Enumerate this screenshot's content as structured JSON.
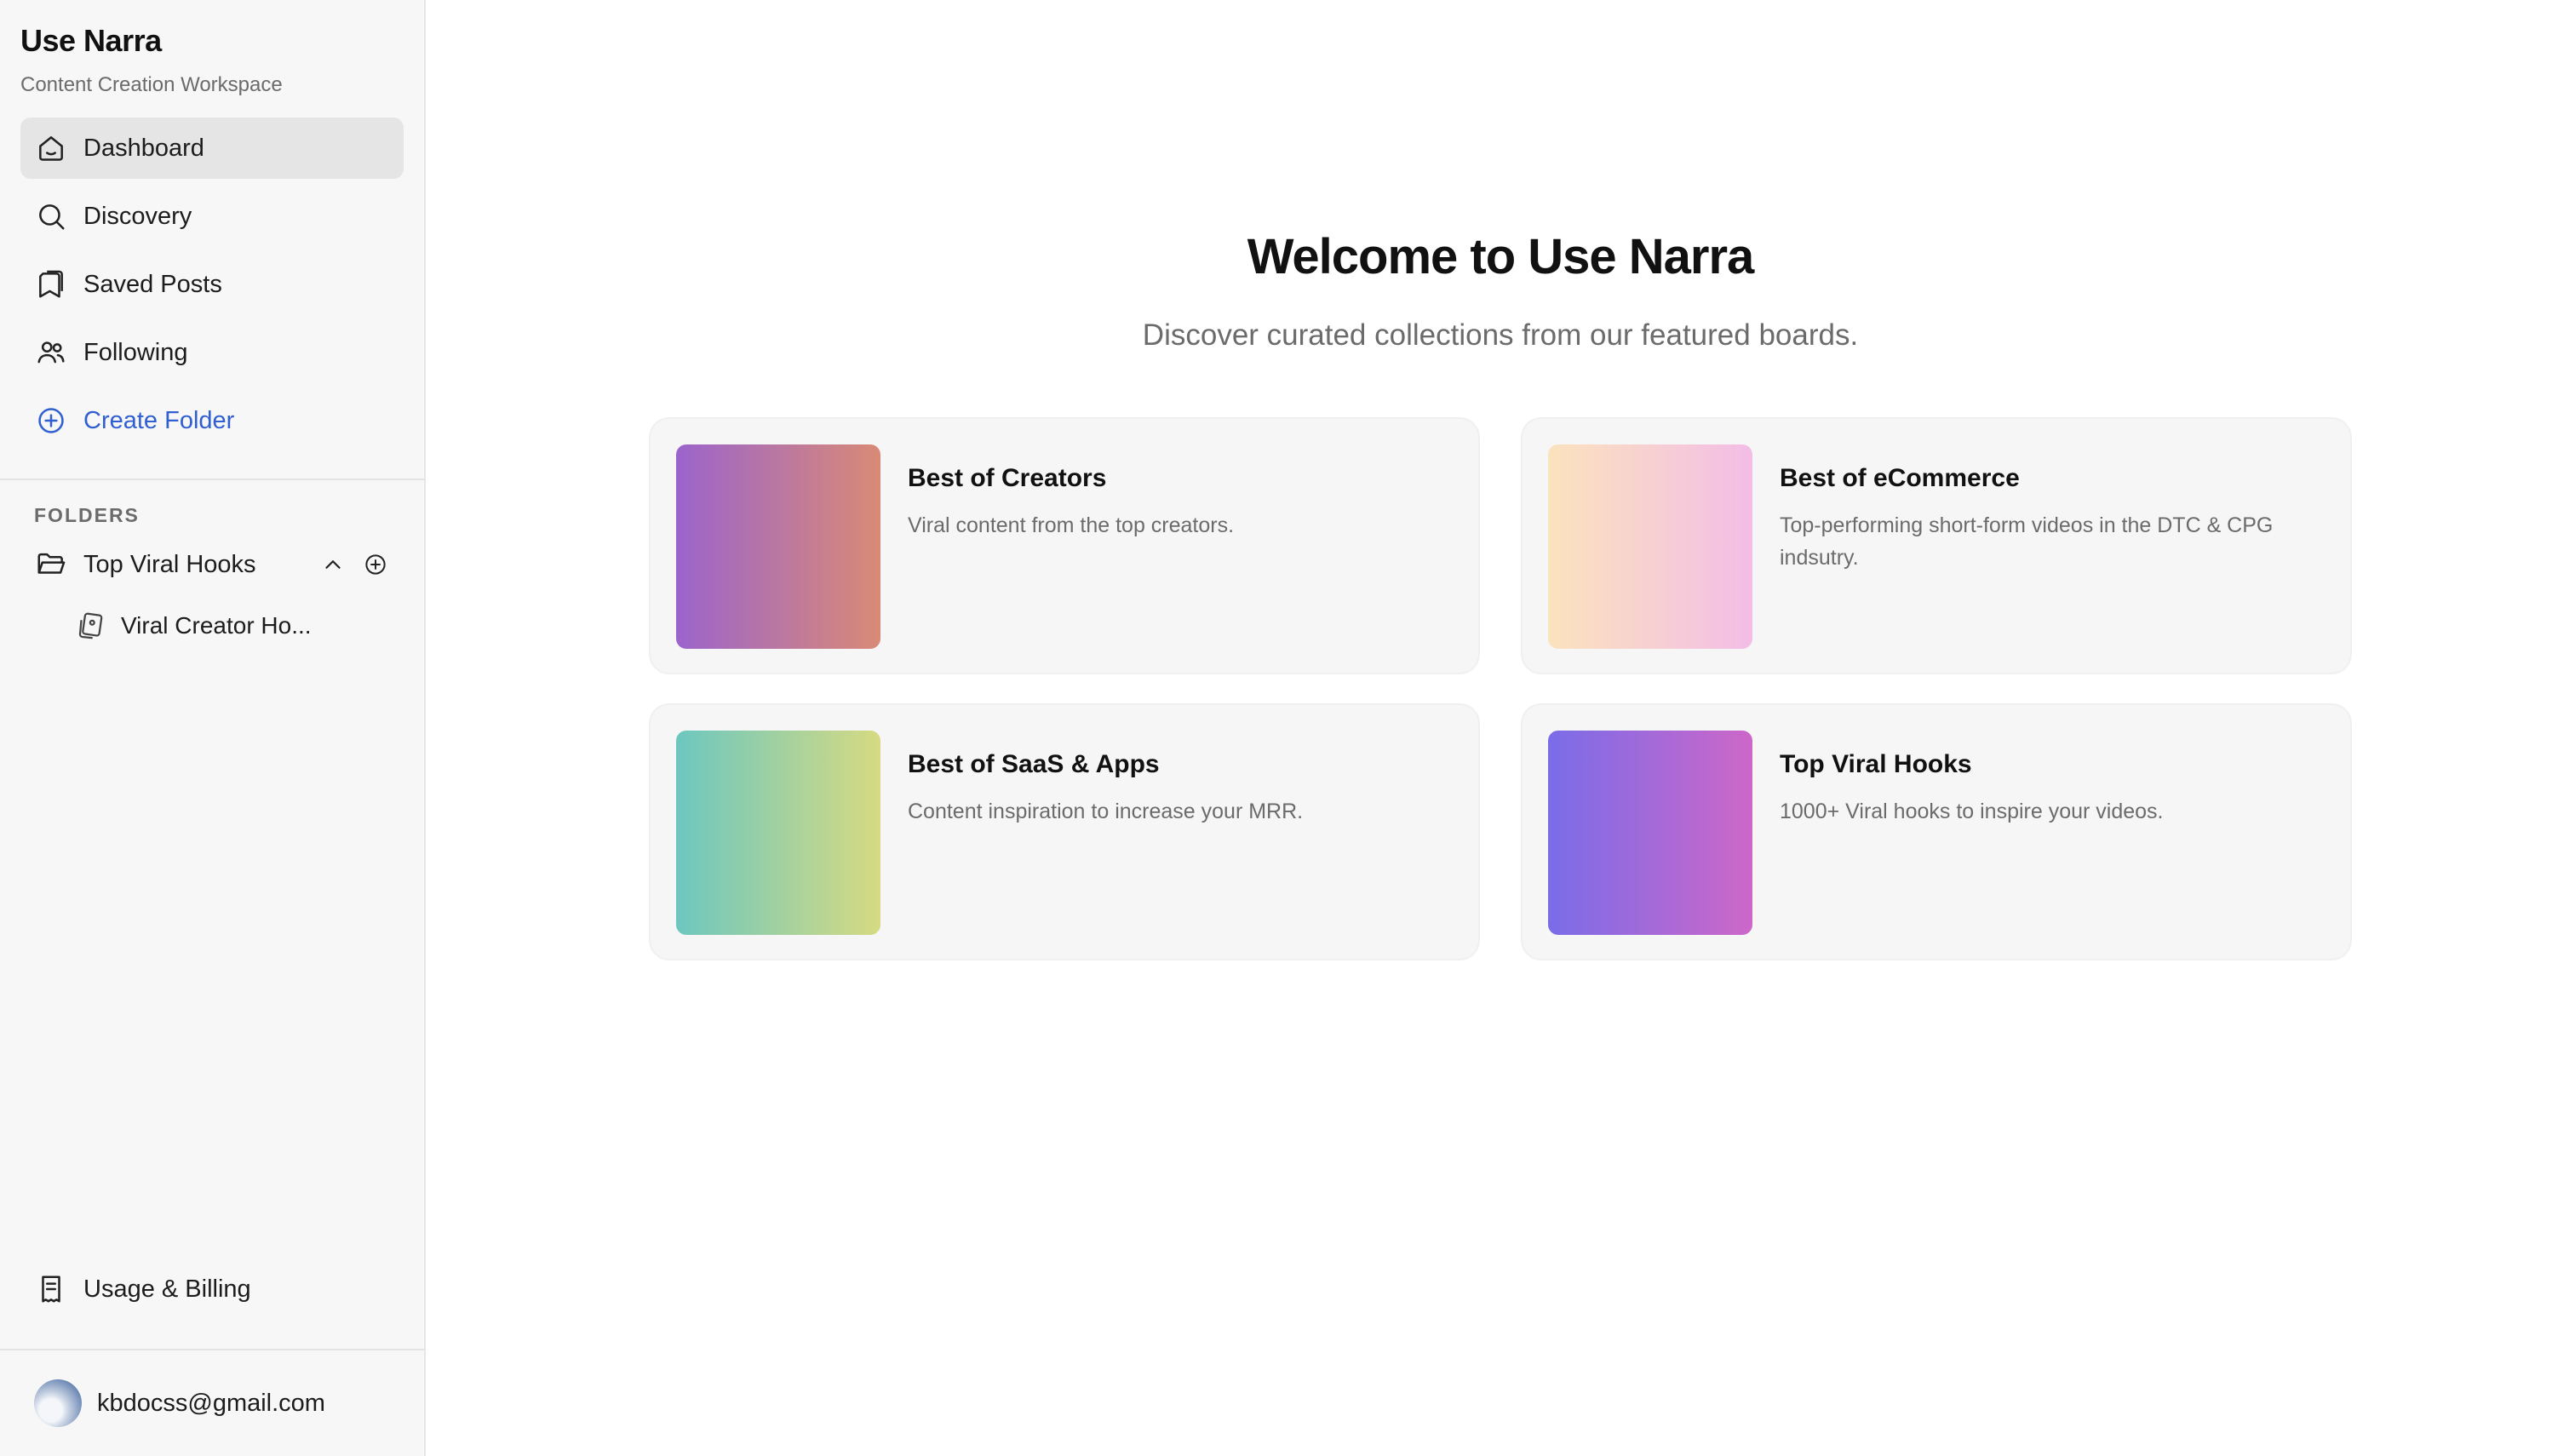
{
  "app": {
    "title": "Use Narra",
    "subtitle": "Content Creation Workspace"
  },
  "nav": {
    "items": [
      {
        "label": "Dashboard",
        "icon": "home-icon",
        "active": true
      },
      {
        "label": "Discovery",
        "icon": "search-icon"
      },
      {
        "label": "Saved Posts",
        "icon": "bookmark-icon"
      },
      {
        "label": "Following",
        "icon": "users-icon"
      },
      {
        "label": "Create Folder",
        "icon": "plus-circle-icon",
        "accent": "#2f5fd0"
      }
    ]
  },
  "folders": {
    "heading": "FOLDERS",
    "items": [
      {
        "label": "Top Viral Hooks",
        "icon": "folder-open-icon",
        "expanded": true,
        "children": [
          {
            "label": "Viral Creator Ho...",
            "icon": "cards-icon"
          }
        ]
      }
    ]
  },
  "billing": {
    "label": "Usage & Billing",
    "icon": "receipt-icon"
  },
  "account": {
    "email": "kbdocss@gmail.com"
  },
  "main": {
    "welcome": "Welcome to Use Narra",
    "subtitle": "Discover curated collections from our featured boards.",
    "boards": [
      {
        "title": "Best of Creators",
        "description": "Viral content from the top creators.",
        "gradient": [
          "#9b64cc",
          "#d98a76"
        ]
      },
      {
        "title": "Best of eCommerce",
        "description": "Top-performing short-form videos in the DTC & CPG indsutry.",
        "gradient": [
          "#fbe3bd",
          "#f3bde6"
        ]
      },
      {
        "title": "Best of SaaS & Apps",
        "description": "Content inspiration to increase your MRR.",
        "gradient": [
          "#6cc7bf",
          "#d6da82"
        ]
      },
      {
        "title": "Top Viral Hooks",
        "description": "1000+ Viral hooks to inspire your videos.",
        "gradient": [
          "#7a6ce8",
          "#cd67c9"
        ]
      }
    ]
  }
}
